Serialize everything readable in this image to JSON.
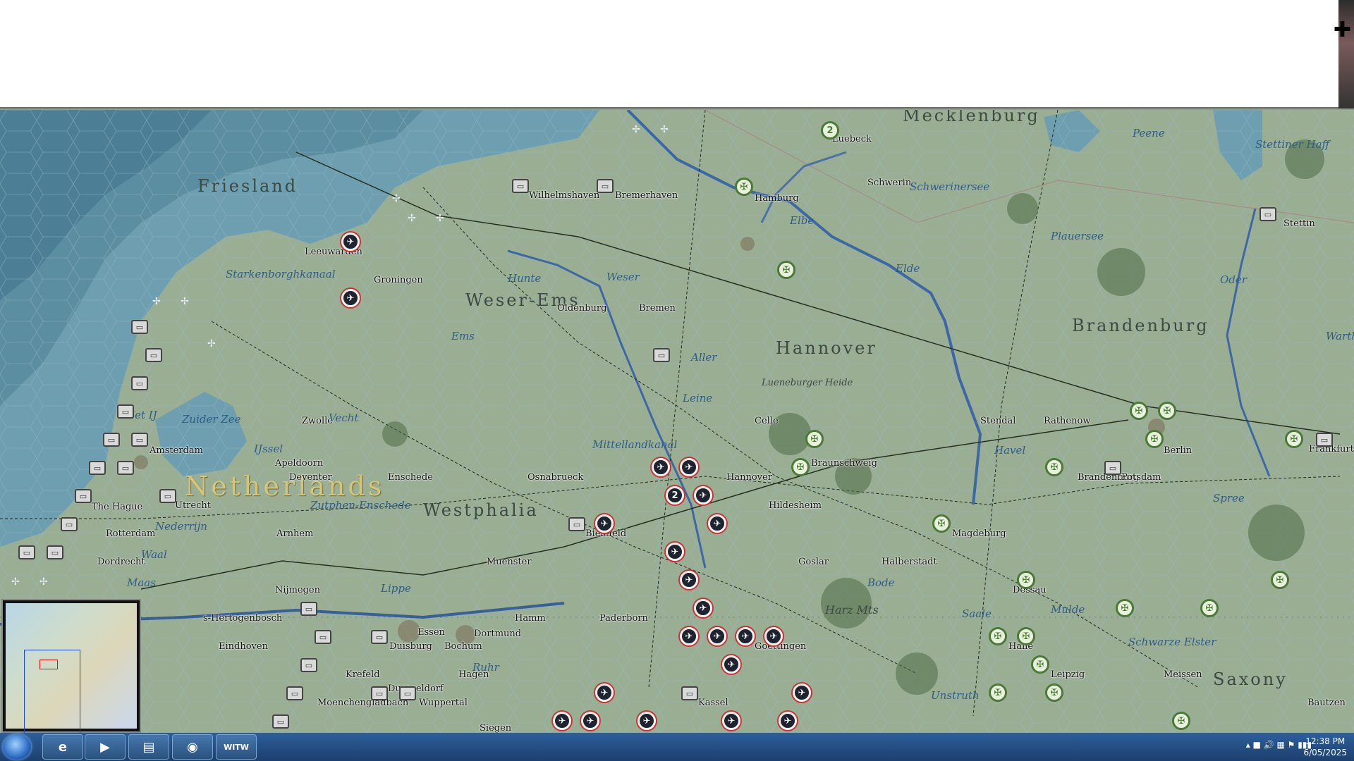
{
  "top_panel": {
    "crosshair_icon": "crosshair-icon"
  },
  "map": {
    "regions": [
      "Friesland",
      "Mecklenburg",
      "Weser-Ems",
      "Hannover",
      "Brandenburg",
      "Westphalia",
      "Saxony"
    ],
    "country": "Netherlands",
    "cities": [
      "Luebeck",
      "Hamburg",
      "Schwerin",
      "Stettin",
      "Wilhelmshaven",
      "Bremerhaven",
      "Leeuwarden",
      "Groningen",
      "Oldenburg",
      "Bremen",
      "Amsterdam",
      "Zwolle",
      "Apeldoorn",
      "Deventer",
      "Enschede",
      "Osnabrueck",
      "Hannover",
      "Braunschweig",
      "Celle",
      "Stendal",
      "Rathenow",
      "Berlin",
      "Brandenburg",
      "Potsdam",
      "Frankfurt",
      "Utrecht",
      "The Hague",
      "Rotterdam",
      "Arnhem",
      "Dordrecht",
      "Nijmegen",
      "Hildesheim",
      "Bielefeld",
      "Muenster",
      "Goslar",
      "Halberstadt",
      "Magdeburg",
      "Dessau",
      "s-Hertogenbosch",
      "Eindhoven",
      "Paderborn",
      "Essen",
      "Duisburg",
      "Bochum",
      "Dortmund",
      "Hamm",
      "Goettingen",
      "Halle",
      "Leipzig",
      "Meissen",
      "Krefeld",
      "Hagen",
      "Duesseldorf",
      "Wuppertal",
      "Moenchengladbach",
      "Kassel",
      "Bautzen",
      "Siegen"
    ],
    "water": [
      "Elbe",
      "Weser",
      "Hunte",
      "Ems",
      "Aller",
      "Leine",
      "Mittellandkanal",
      "Zuider Zee",
      "Het IJ",
      "IJssel",
      "Vecht",
      "Nederrijn",
      "Waal",
      "Maas",
      "Lippe",
      "Ruhr",
      "Havel",
      "Spree",
      "Oder",
      "Peene",
      "Saale",
      "Mulde",
      "Unstruth",
      "Schwarze Elster",
      "Bode",
      "Plauersee",
      "Schwerinersee",
      "Stettiner Haff",
      "Starkenborghkanaal",
      "Zutphen-Enschede",
      "Elde",
      "Warthe"
    ],
    "terrain": [
      "Harz Mts",
      "Lueneburger Heide"
    ],
    "stack_counts": [
      "2",
      "2"
    ],
    "unit_symbols": [
      "eagle-counter",
      "panzer-counter",
      "aircraft-counter",
      "fortification-counter"
    ]
  },
  "minimap": {
    "label": "Europe overview"
  },
  "taskbar": {
    "apps": [
      "start-orb",
      "internet-explorer",
      "media-player",
      "file-explorer",
      "chrome",
      "witw"
    ],
    "witw_label": "WITW",
    "clock_time": "12:38 PM",
    "clock_date": "6/05/2025"
  }
}
